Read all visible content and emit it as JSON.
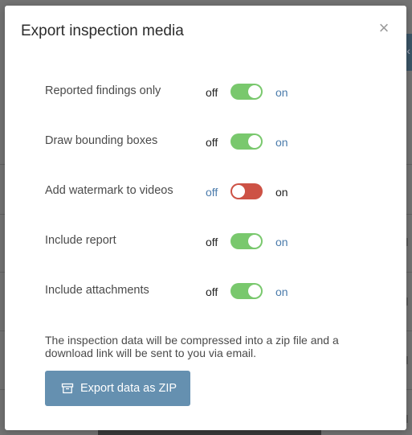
{
  "dialog": {
    "title": "Export inspection media",
    "close_symbol": "×"
  },
  "options": [
    {
      "label": "Reported findings only",
      "off_label": "off",
      "on_label": "on",
      "state": "on"
    },
    {
      "label": "Draw bounding boxes",
      "off_label": "off",
      "on_label": "on",
      "state": "on"
    },
    {
      "label": "Add watermark to videos",
      "off_label": "off",
      "on_label": "on",
      "state": "off"
    },
    {
      "label": "Include report",
      "off_label": "off",
      "on_label": "on",
      "state": "on"
    },
    {
      "label": "Include attachments",
      "off_label": "off",
      "on_label": "on",
      "state": "on"
    }
  ],
  "info_text": "The inspection data will be compressed into a zip file and a download link will be sent to you via email.",
  "export_button": {
    "label": "Export data as ZIP",
    "icon": "archive-icon"
  },
  "colors": {
    "toggle_on": "#79c86d",
    "toggle_off": "#cd5245",
    "button": "#6590b0",
    "inactive_option": "#4a7bab"
  }
}
